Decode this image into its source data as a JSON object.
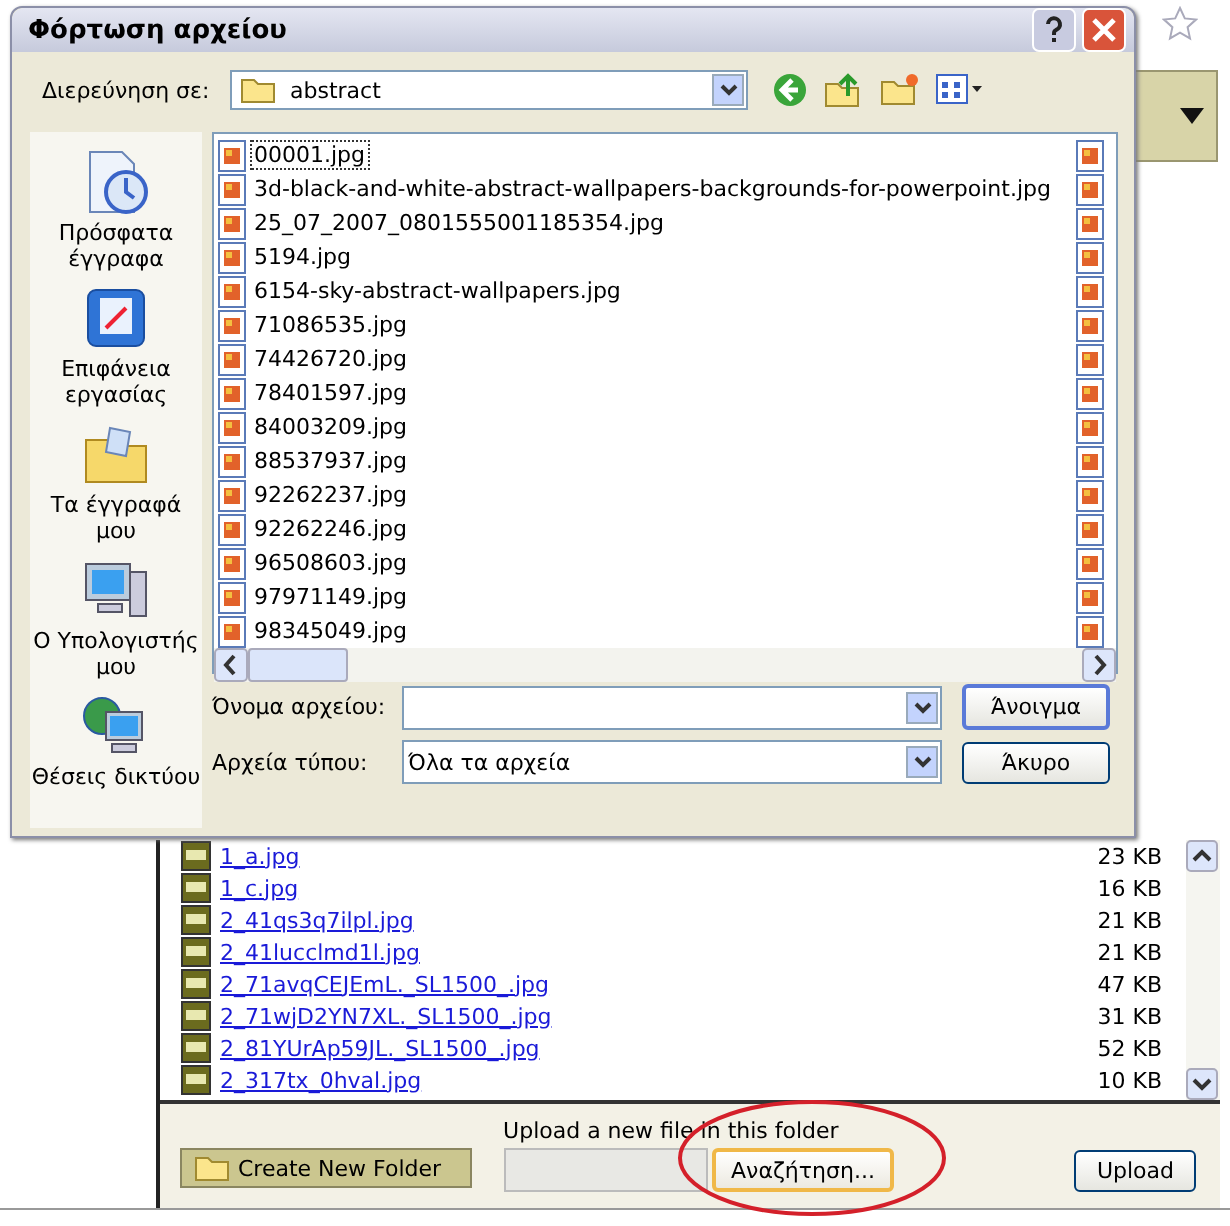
{
  "dialog": {
    "title": "Φόρτωση αρχείου",
    "look_in_label": "Διερεύνηση σε:",
    "folder": "abstract",
    "places": [
      {
        "label": "Πρόσφατα έγγραφα",
        "kind": "recent"
      },
      {
        "label": "Επιφάνεια εργασίας",
        "kind": "desktop"
      },
      {
        "label": "Τα έγγραφά μου",
        "kind": "documents"
      },
      {
        "label": "Ο Υπολογιστής μου",
        "kind": "computer"
      },
      {
        "label": "Θέσεις δικτύου",
        "kind": "network"
      }
    ],
    "files": [
      {
        "name": "00001.jpg",
        "selected": true
      },
      {
        "name": "3d-black-and-white-abstract-wallpapers-backgrounds-for-powerpoint.jpg",
        "selected": false
      },
      {
        "name": "25_07_2007_0801555001185354.jpg",
        "selected": false
      },
      {
        "name": "5194.jpg",
        "selected": false
      },
      {
        "name": "6154-sky-abstract-wallpapers.jpg",
        "selected": false
      },
      {
        "name": "71086535.jpg",
        "selected": false
      },
      {
        "name": "74426720.jpg",
        "selected": false
      },
      {
        "name": "78401597.jpg",
        "selected": false
      },
      {
        "name": "84003209.jpg",
        "selected": false
      },
      {
        "name": "88537937.jpg",
        "selected": false
      },
      {
        "name": "92262237.jpg",
        "selected": false
      },
      {
        "name": "92262246.jpg",
        "selected": false
      },
      {
        "name": "96508603.jpg",
        "selected": false
      },
      {
        "name": "97971149.jpg",
        "selected": false
      },
      {
        "name": "98345049.jpg",
        "selected": false
      }
    ],
    "file_name_label": "Όνομα αρχείου:",
    "file_type_label": "Αρχεία τύπου:",
    "file_type": "Όλα τα αρχεία",
    "open_button": "Άνοιγμα",
    "cancel_button": "Άκυρο"
  },
  "file_list": [
    {
      "name": "1_a.jpg",
      "size": "23 KB"
    },
    {
      "name": "1_c.jpg",
      "size": "16 KB"
    },
    {
      "name": "2_41qs3q7ilpl.jpg",
      "size": "21 KB"
    },
    {
      "name": "2_41lucclmd1l.jpg",
      "size": "21 KB"
    },
    {
      "name": "2_71avqCEJEmL._SL1500_.jpg",
      "size": "47 KB"
    },
    {
      "name": "2_71wjD2YN7XL._SL1500_.jpg",
      "size": "31 KB"
    },
    {
      "name": "2_81YUrAp59JL._SL1500_.jpg",
      "size": "52 KB"
    },
    {
      "name": "2_317tx_0hval.jpg",
      "size": "10 KB"
    }
  ],
  "upload_bar": {
    "create_folder": "Create New Folder",
    "upload_label": "Upload a new file in this folder",
    "browse_button": "Αναζήτηση...",
    "upload_button": "Upload"
  }
}
